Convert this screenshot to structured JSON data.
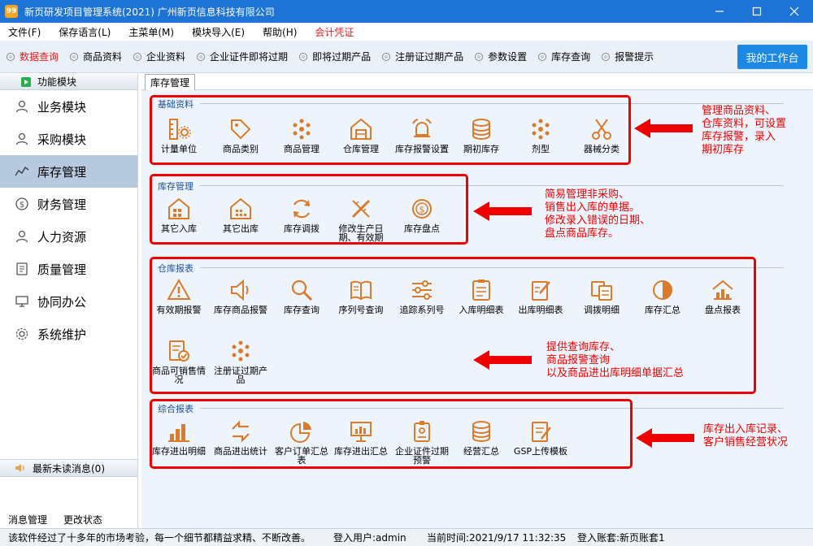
{
  "window": {
    "logo_text": "99",
    "title": "新页研发项目管理系统(2021) 广州新页信息科技有限公司"
  },
  "menu": [
    {
      "label": "文件(F)",
      "accent": false
    },
    {
      "label": "保存语言(L)",
      "accent": false
    },
    {
      "label": "主菜单(M)",
      "accent": false
    },
    {
      "label": "模块导入(E)",
      "accent": false
    },
    {
      "label": "帮助(H)",
      "accent": false
    },
    {
      "label": "会计凭证",
      "accent": true
    }
  ],
  "toolbar": {
    "items": [
      {
        "label": "数据查询",
        "active": true
      },
      {
        "label": "商品资料",
        "active": false
      },
      {
        "label": "企业资料",
        "active": false
      },
      {
        "label": "企业证件即将过期",
        "active": false
      },
      {
        "label": "即将过期产品",
        "active": false
      },
      {
        "label": "注册证过期产品",
        "active": false
      },
      {
        "label": "参数设置",
        "active": false
      },
      {
        "label": "库存查询",
        "active": false
      },
      {
        "label": "报警提示",
        "active": false
      }
    ],
    "workbench_label": "我的工作台"
  },
  "sidebar": {
    "header": "功能模块",
    "items": [
      {
        "label": "业务模块",
        "icon": "user-icon",
        "selected": false
      },
      {
        "label": "采购模块",
        "icon": "person-icon",
        "selected": false
      },
      {
        "label": "库存管理",
        "icon": "chart-icon",
        "selected": true
      },
      {
        "label": "财务管理",
        "icon": "money-icon",
        "selected": false
      },
      {
        "label": "人力资源",
        "icon": "person-icon",
        "selected": false
      },
      {
        "label": "质量管理",
        "icon": "document-icon",
        "selected": false
      },
      {
        "label": "协同办公",
        "icon": "monitor-icon",
        "selected": false
      },
      {
        "label": "系统维护",
        "icon": "gear-icon",
        "selected": false
      }
    ],
    "messages_label": "最新未读消息(0)",
    "bottom_links": [
      "消息管理",
      "更改状态"
    ]
  },
  "tab": {
    "label": "库存管理"
  },
  "sections": {
    "basic": {
      "title": "基础资料",
      "items": [
        "计量单位",
        "商品类别",
        "商品管理",
        "仓库管理",
        "库存报警设置",
        "期初库存",
        "剂型",
        "器械分类"
      ]
    },
    "stock": {
      "title": "库存管理",
      "items": [
        "其它入库",
        "其它出库",
        "库存调拨",
        "修改生产日期、有效期",
        "库存盘点"
      ]
    },
    "reports": {
      "title": "仓库报表",
      "items": [
        "有效期报警",
        "库存商品报警",
        "库存查询",
        "序列号查询",
        "追踪系列号",
        "入库明细表",
        "出库明细表",
        "调拨明细",
        "库存汇总",
        "盘点报表",
        "商品可销售情况",
        "注册证过期产品"
      ]
    },
    "summary": {
      "title": "综合报表",
      "items": [
        "库存进出明细",
        "商品进出统计",
        "客户订单汇总表",
        "库存进出汇总",
        "企业证件过期预警",
        "经营汇总",
        "GSP上传模板"
      ]
    }
  },
  "annotations": {
    "basic": [
      "管理商品资料、",
      "仓库资料，可设置",
      "库存报警，录入",
      "期初库存"
    ],
    "stock": [
      "简易管理非采购、",
      "销售出入库的单据。",
      "修改录入错误的日期、",
      "盘点商品库存。"
    ],
    "reports": [
      "提供查询库存、",
      "商品报警查询",
      "以及商品进出库明细单据汇总"
    ],
    "summary": [
      "库存出入库记录、",
      "客户销售经营状况"
    ]
  },
  "status": {
    "slogan": "该软件经过了十多年的市场考验，每一个细节都精益求精、不断改善。",
    "user": "登入用户:admin",
    "time": "当前时间:2021/9/17 11:32:35",
    "account": "登入账套:新页账套1"
  },
  "colors": {
    "titlebar": "#1e73d6",
    "accent_red": "#e02020",
    "icon_orange": "#d97b2b",
    "workbench": "#1e88e5",
    "selected": "#b7c9de"
  }
}
